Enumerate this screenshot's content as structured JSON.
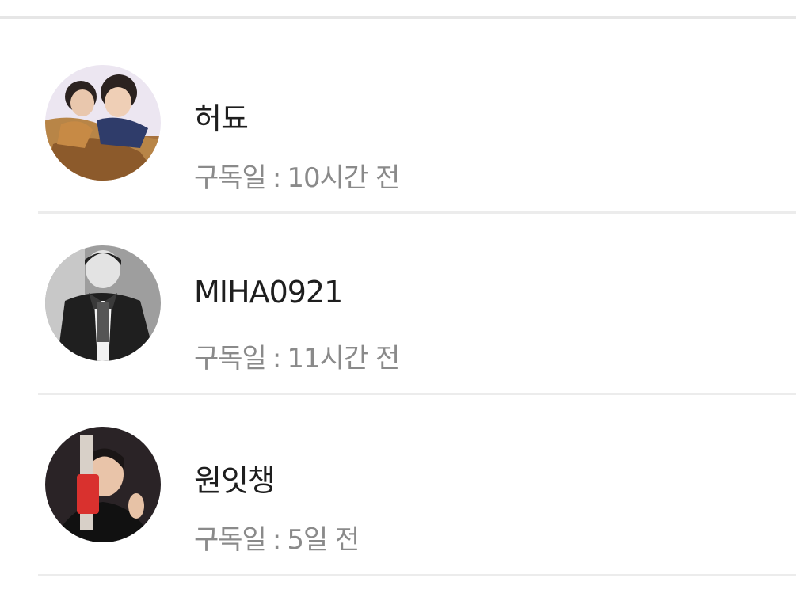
{
  "subscribers": [
    {
      "name": "허됴",
      "date_label": "구독일",
      "separator": ":",
      "time": "10시간 전",
      "avatar": "avatar-photo-two-people"
    },
    {
      "name": "MIHA0921",
      "date_label": "구독일",
      "separator": ":",
      "time": "11시간 전",
      "avatar": "avatar-photo-monochrome"
    },
    {
      "name": "원잇챙",
      "date_label": "구독일",
      "separator": ":",
      "time": "5일 전",
      "avatar": "avatar-photo-dark"
    }
  ],
  "colors": {
    "name": "#1e1e1e",
    "meta": "#8a8a8a",
    "divider": "#ececec"
  }
}
